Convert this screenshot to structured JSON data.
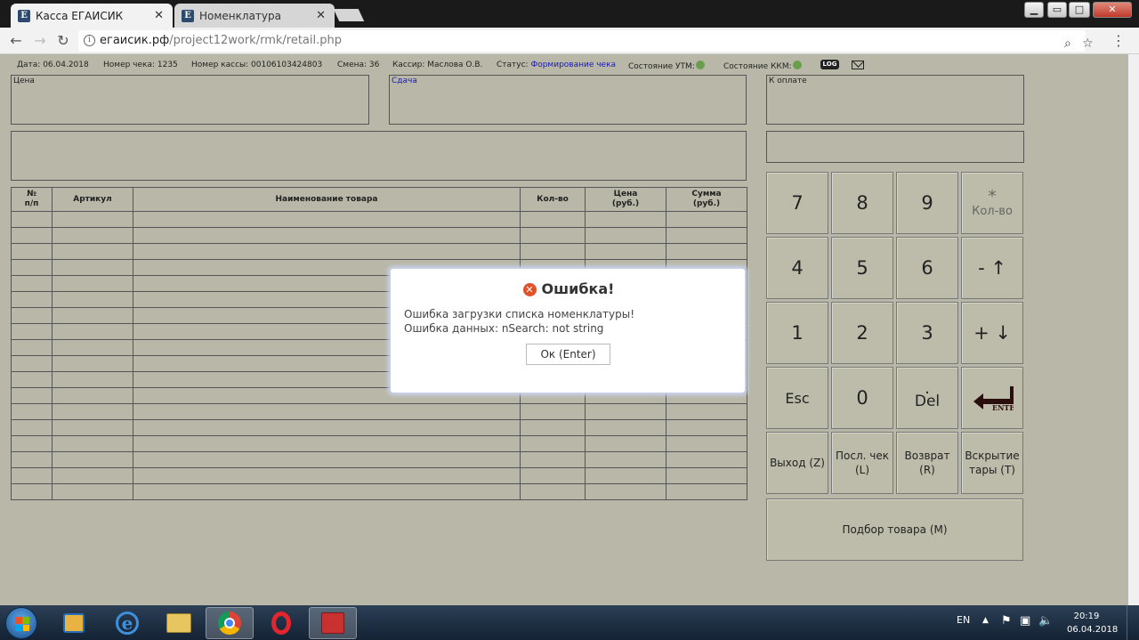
{
  "browser": {
    "tabs": [
      {
        "label": "Касса ЕГАИСИК",
        "active": true
      },
      {
        "label": "Номенклатура",
        "active": false
      }
    ],
    "close_glyph": "✕",
    "favicon_letter": "E",
    "url_domain": "егаисик.рф",
    "url_path": "/project12work/rmk/retail.php",
    "info_glyph": "i",
    "back_glyph": "←",
    "forward_glyph": "→",
    "reload_glyph": "↻",
    "zoom_glyph": "⌕",
    "star_glyph": "☆",
    "menu_glyph": "⋮"
  },
  "status": {
    "date": "Дата: 06.04.2018",
    "check_no": "Номер чека: 1235",
    "register_no": "Номер кассы: 00106103424803",
    "shift": "Смена: 36",
    "cashier": "Кассир: Маслова О.В.",
    "status_label": "Статус:",
    "status_value": "Формирование чека",
    "utm_label": "Состояние УТМ:",
    "kkm_label": "Состояние ККМ:",
    "log_label": "LOG"
  },
  "fields": {
    "price_label": "Цена",
    "change_label": "Сдача",
    "topay_label": "К оплате"
  },
  "table": {
    "headers": [
      "№\nп/п",
      "Артикул",
      "Наименование товара",
      "Кол-во",
      "Цена\n(руб.)",
      "Сумма\n(руб.)"
    ],
    "row_count": 18
  },
  "keypad": {
    "k7": "7",
    "k8": "8",
    "k9": "9",
    "star_sym": "*",
    "star_sub": "Кол-во",
    "k4": "4",
    "k5": "5",
    "k6": "6",
    "minus": "- ↑",
    "k1": "1",
    "k2": "2",
    "k3": "3",
    "plus": "+ ↓",
    "esc": "Esc",
    "k0": "0",
    "del_dot": ".",
    "del": "Del",
    "enter": "ENTER",
    "exit": "Выход (Z)",
    "last_check": "Посл. чек (L)",
    "return": "Возврат (R)",
    "open_tare": "Вскрытие тары (T)",
    "pick": "Подбор товара (М)"
  },
  "modal": {
    "error_glyph": "✕",
    "title": "Ошибка!",
    "line1": "Ошибка загрузки списка номенклатуры!",
    "line2": "Ошибка данных: nSearch: not string",
    "ok_label": "Ок (Enter)"
  },
  "taskbar": {
    "lang": "EN",
    "time": "20:19",
    "date": "06.04.2018"
  },
  "colors": {
    "page_bg": "#b9b8a8",
    "status_blue": "#1a1aa8",
    "ok_green": "#6a9e4e",
    "error_red": "#e2512a"
  }
}
